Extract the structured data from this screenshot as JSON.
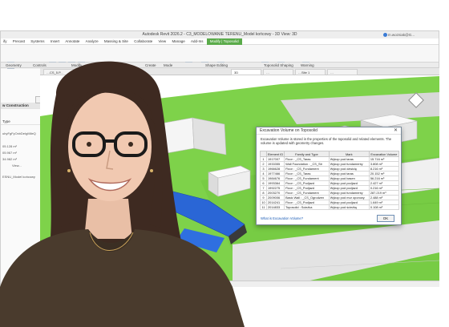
{
  "window": {
    "title": "Autodesk Revit 2026.2 - C3_MODELOWANIE TERENU_Model końcowy - 3D View: 3D",
    "user": "m.wozniak@G..."
  },
  "menu": {
    "items": [
      "ify",
      "Precast",
      "Systems",
      "Insert",
      "Annotate",
      "Analyze",
      "Massing & Site",
      "Collaborate",
      "View",
      "Manage",
      "Add-Ins"
    ],
    "context_tab": "Modify | Toposolid"
  },
  "ribbon": {
    "groups": [
      "Geometry",
      "Controls",
      "Modify",
      "Create",
      "Mode",
      "Shape Editing",
      "Toposolid Shaping",
      "Warning"
    ]
  },
  "properties_panel": {
    "labels": [
      "w Construction",
      "Type",
      "ubyFgFyOxbDeIgMileQ",
      "05.128 m²",
      "05.967 m²",
      "34.982 m³",
      "View...",
      "ESNU_Model końcowy"
    ],
    "edit_type_button": "Edit Type"
  },
  "view_tabs": [
    "…CS_5.P...",
    "…CS_3D...",
    "…CS_5.P...",
    "3D",
    "…",
    "…Site 1",
    "…"
  ],
  "statusbar": {
    "model_label": "Main Model"
  },
  "dialog": {
    "title": "Excavation Volume on Toposolid",
    "description": "Excavation Volume is stored in the properties of the toposolid and related elements. The volume is updated with geometry changes.",
    "columns": [
      "",
      "Element ID",
      "Family and Type",
      "Mark",
      "Excavation Volume"
    ],
    "rows": [
      [
        "1",
        "1917007",
        "Floor : _CS_Taras",
        "Wykop pod taras",
        "15.716 m³"
      ],
      [
        "2",
        "1933355",
        "Wall Foundation : _CS_Str",
        "Wykop pod fundamenty",
        "3.808 m³"
      ],
      [
        "3",
        "1966628",
        "Floor : _CS_Fundament",
        "Wykop pod dźwicię",
        "8.216 m³"
      ],
      [
        "4",
        "1977466",
        "Floor : _CS_Taras",
        "Wykop pod taras",
        "20.152 m³"
      ],
      [
        "5",
        "1984676",
        "Floor : _CS_Fundament",
        "Wykop pod basen",
        "56.216 m³"
      ],
      [
        "6",
        "1993364",
        "Floor : _CS_Podjazd",
        "Wykop pod podjazd",
        "2.427 m³"
      ],
      [
        "7",
        "1992275",
        "Floor : _CS_Podjazd",
        "Wykop pod podjazd",
        "0.216 m³"
      ],
      [
        "8",
        "2003270",
        "Floor : _CS_Fundament",
        "Wykop pod fundamenty",
        "287.219 m³"
      ],
      [
        "9",
        "2009006",
        "Basic Wall : _CS_Ogrodzen",
        "Wykop pod mur oporowy",
        "2.488 m³"
      ],
      [
        "10",
        "2014241",
        "Floor : _CS_Podjazd",
        "Wykop pod podjazd",
        "1.649 m³"
      ],
      [
        "11",
        "2014833",
        "Toposolid : Scieżka",
        "Wykop pod ścieżkę",
        "0.108 m³"
      ]
    ],
    "help_link": "What is Excavation Volume?",
    "ok_label": "OK"
  },
  "colors": {
    "grass": "#7ed24a",
    "water": "#2a66d6",
    "ribbon_context": "#5aab4a",
    "sweater": "#4a3b2d",
    "hair": "#3e2a21"
  }
}
